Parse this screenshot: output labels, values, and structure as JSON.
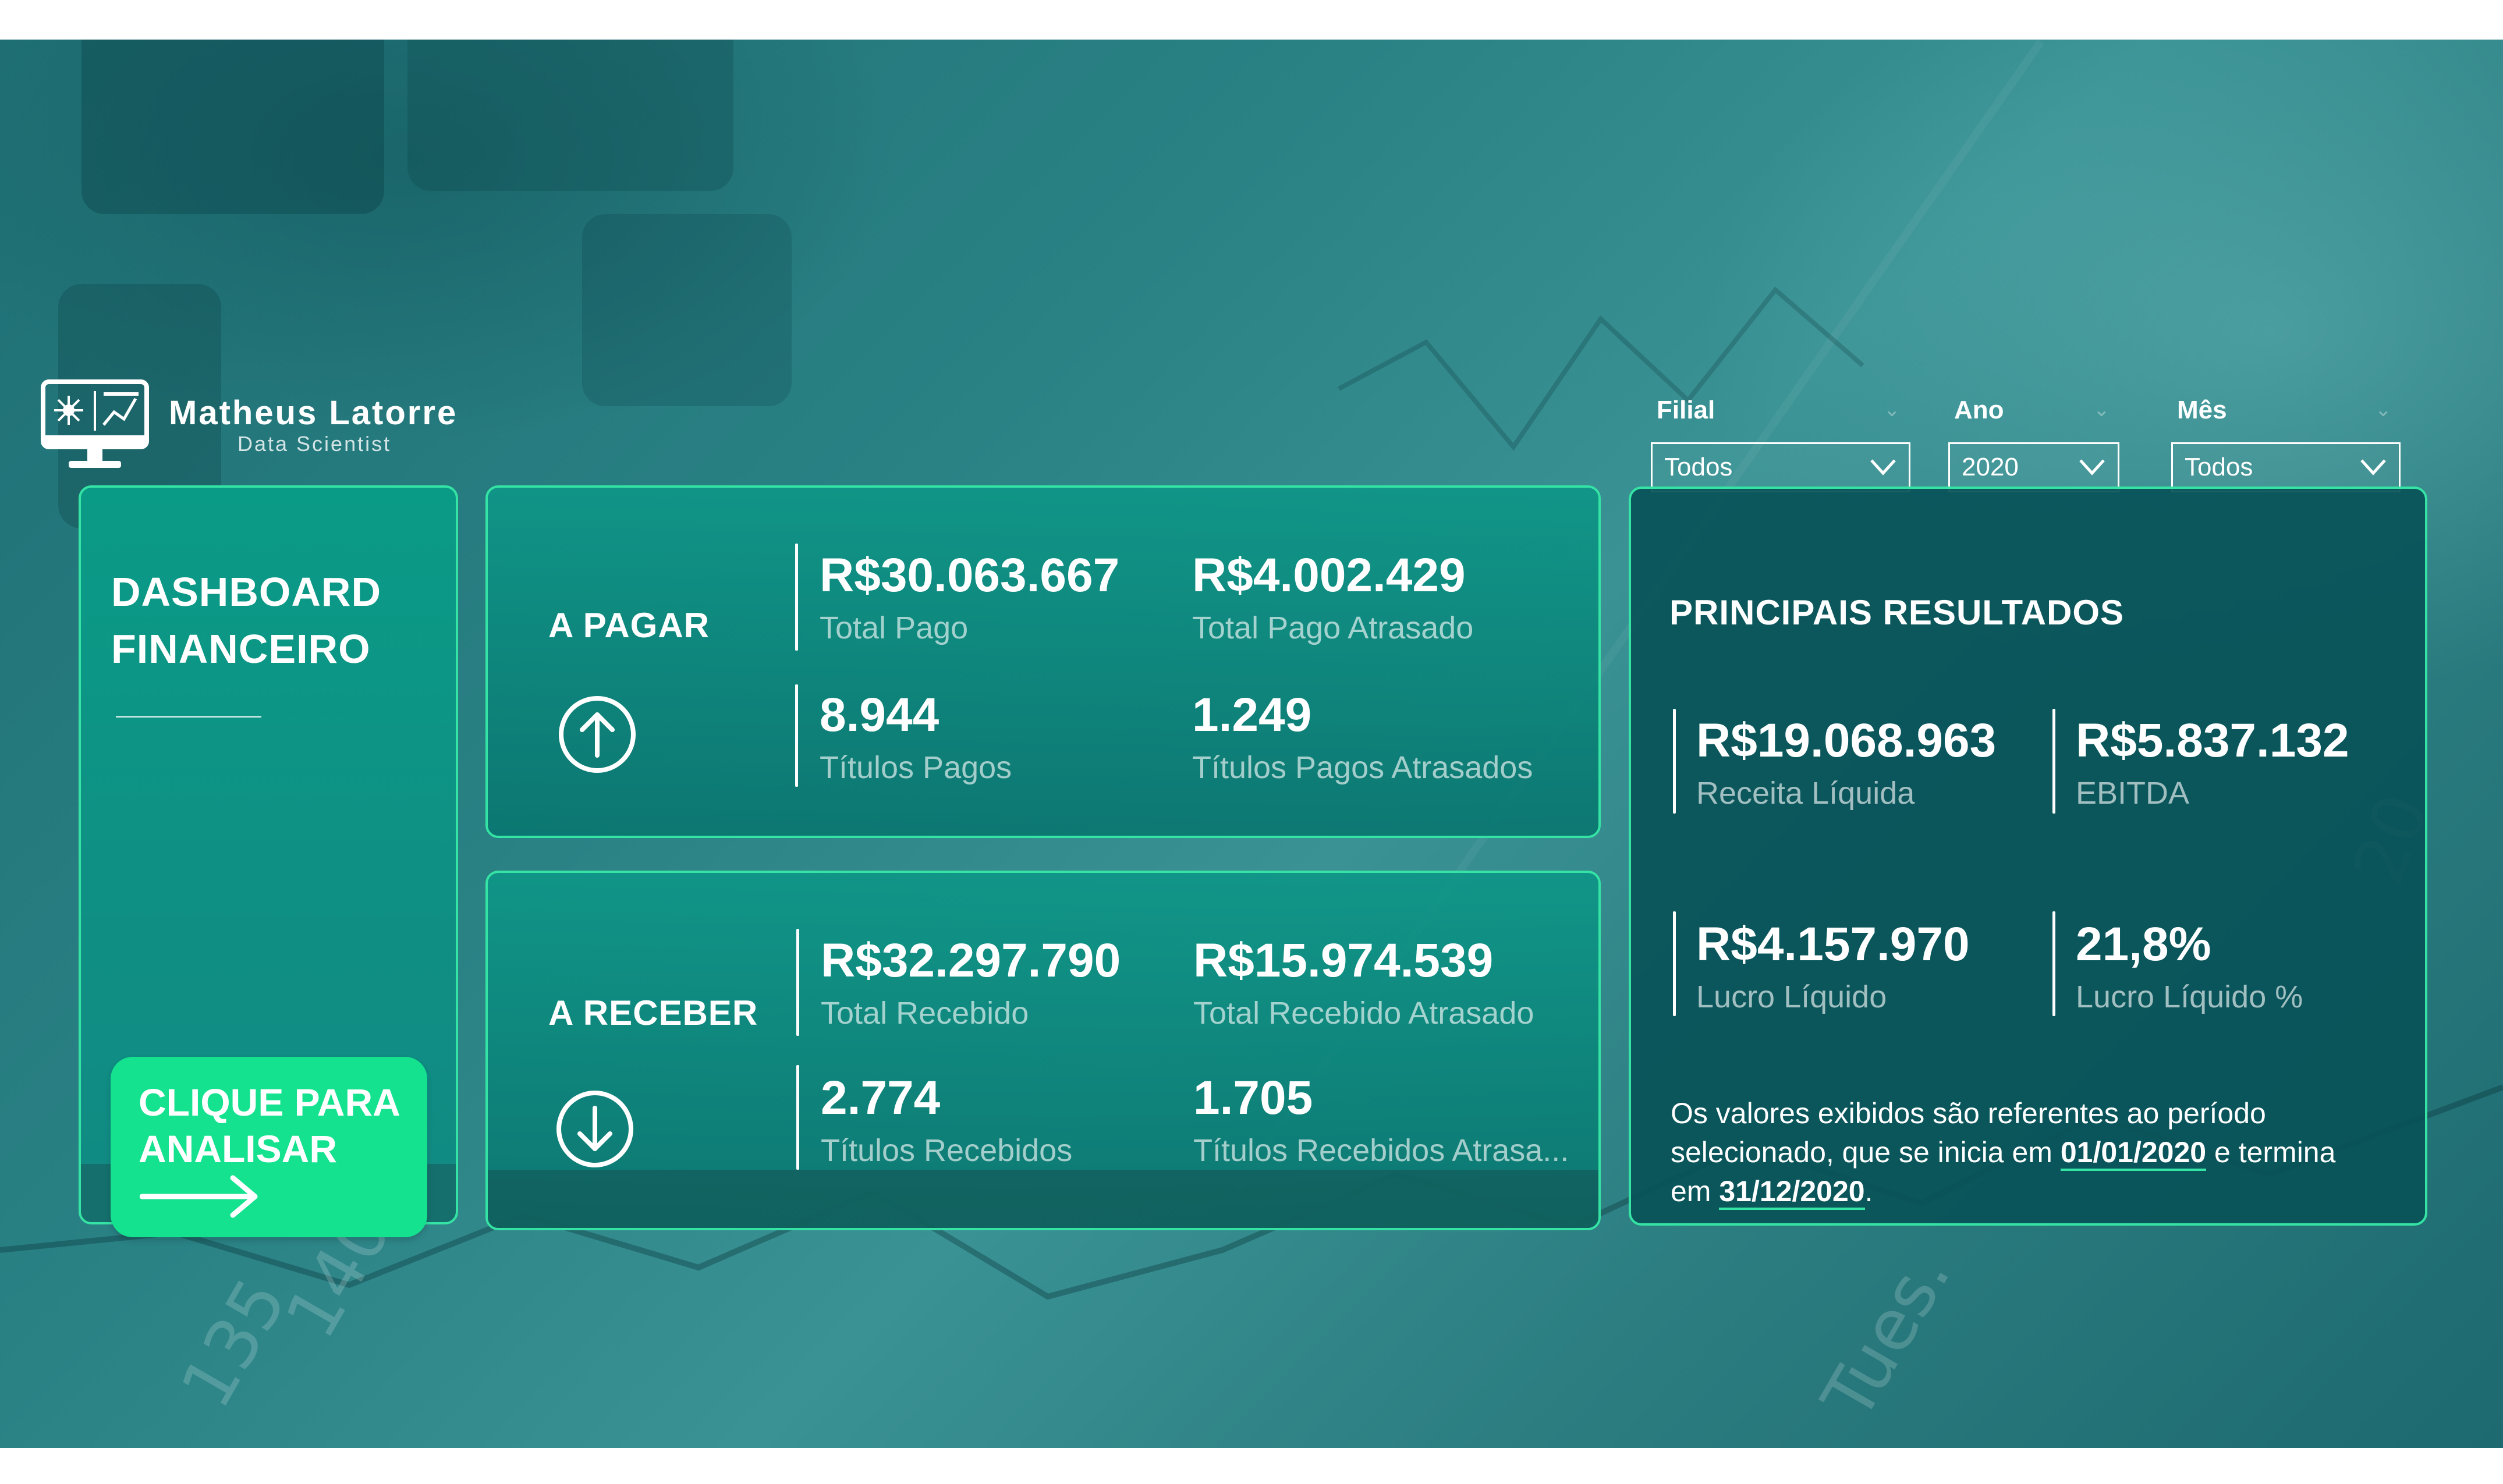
{
  "brand": {
    "name": "Matheus Latorre",
    "subtitle": "Data Scientist",
    "logo_icon": "monitor-analytics-icon"
  },
  "filters": [
    {
      "label": "Filial",
      "value": "Todos"
    },
    {
      "label": "Ano",
      "value": "2020"
    },
    {
      "label": "Mês",
      "value": "Todos"
    }
  ],
  "left_panel": {
    "title_line1": "DASHBOARD",
    "title_line2": "FINANCEIRO",
    "cta_line1": "CLIQUE PARA",
    "cta_line2": "ANALISAR",
    "cta_icon": "arrow-right-icon"
  },
  "a_pagar": {
    "title": "A PAGAR",
    "icon": "arrow-up-circle-icon",
    "metrics": [
      {
        "value": "R$30.063.667",
        "label": "Total Pago"
      },
      {
        "value": "R$4.002.429",
        "label": "Total Pago Atrasado"
      },
      {
        "value": "8.944",
        "label": "Títulos Pagos"
      },
      {
        "value": "1.249",
        "label": "Títulos Pagos Atrasados"
      }
    ]
  },
  "a_receber": {
    "title": "A RECEBER",
    "icon": "arrow-down-circle-icon",
    "metrics": [
      {
        "value": "R$32.297.790",
        "label": "Total Recebido"
      },
      {
        "value": "R$15.974.539",
        "label": "Total Recebido Atrasado"
      },
      {
        "value": "2.774",
        "label": "Títulos Recebidos"
      },
      {
        "value": "1.705",
        "label": "Títulos Recebidos Atrasa..."
      }
    ]
  },
  "resultados": {
    "title": "PRINCIPAIS RESULTADOS",
    "metrics": [
      {
        "value": "R$19.068.963",
        "label": "Receita Líquida"
      },
      {
        "value": "R$5.837.132",
        "label": "EBITDA"
      },
      {
        "value": "R$4.157.970",
        "label": "Lucro Líquido"
      },
      {
        "value": "21,8%",
        "label": "Lucro Líquido %"
      }
    ],
    "note_part1": "Os valores exibidos são referentes ao período selecionado, que se inicia em ",
    "start_date": "01/01/2020",
    "note_part2": " e termina em ",
    "end_date": "31/12/2020",
    "note_part3": "."
  },
  "colors": {
    "accent": "#35e3a4",
    "cta": "#14e28f",
    "card_teal": "#0e8f84",
    "card_dark": "#085258"
  }
}
